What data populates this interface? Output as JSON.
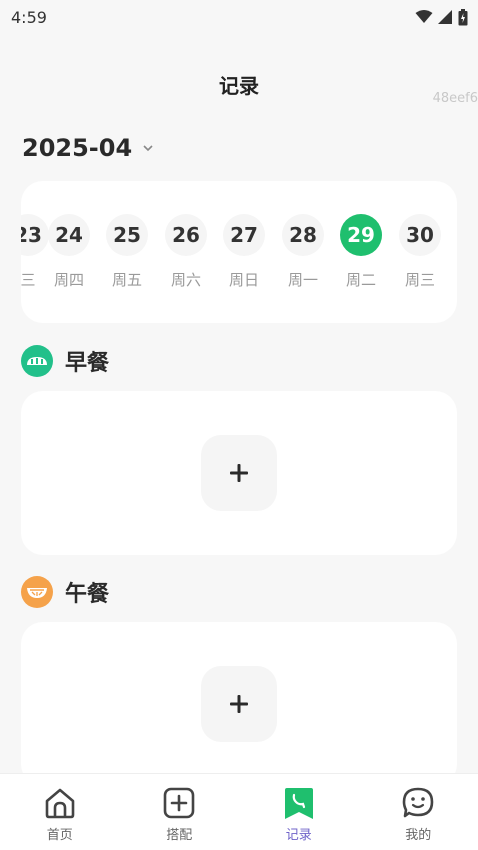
{
  "status_bar": {
    "time": "4:59"
  },
  "header": {
    "title": "记录",
    "watermark": "48eef6"
  },
  "month": {
    "label": "2025-04"
  },
  "calendar": {
    "partial_left": {
      "num": "23",
      "weekday": "三"
    },
    "days": [
      {
        "num": "24",
        "weekday": "周四"
      },
      {
        "num": "25",
        "weekday": "周五"
      },
      {
        "num": "26",
        "weekday": "周六"
      },
      {
        "num": "27",
        "weekday": "周日"
      },
      {
        "num": "28",
        "weekday": "周一"
      },
      {
        "num": "29",
        "weekday": "周二",
        "selected": true
      },
      {
        "num": "30",
        "weekday": "周三"
      }
    ],
    "selected_color": "#1fbf6e"
  },
  "meals": [
    {
      "name": "早餐",
      "icon": "breakfast-bread-icon",
      "color": "#22c08a",
      "add_label": "+"
    },
    {
      "name": "午餐",
      "icon": "lunch-bowl-icon",
      "color": "#f5a24a",
      "add_label": "+"
    }
  ],
  "bottom_nav": {
    "items": [
      {
        "label": "首页",
        "icon": "home-icon"
      },
      {
        "label": "搭配",
        "icon": "plus-square-icon"
      },
      {
        "label": "记录",
        "icon": "bookmark-phone-icon",
        "active": true
      },
      {
        "label": "我的",
        "icon": "smiley-bubble-icon"
      }
    ],
    "active_color": "#6f63c9"
  }
}
